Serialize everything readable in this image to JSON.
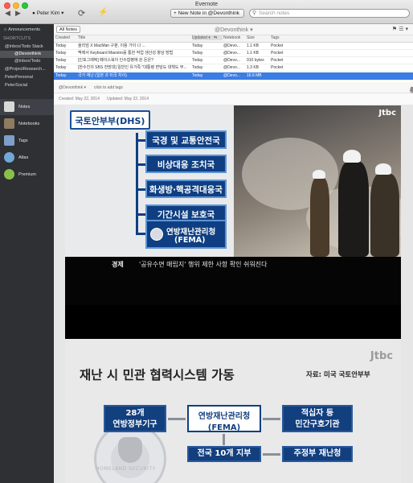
{
  "window": {
    "title": "Evernote"
  },
  "toolbar": {
    "user": "Peter Kim",
    "new_note": "+ New Note in @Devonthink",
    "search_placeholder": "Search notes"
  },
  "sidebar": {
    "announcements": "Announcements",
    "shortcuts_header": "SHORTCUTS",
    "shortcuts": [
      {
        "label": "@Inbox/Todo Stack",
        "selected": false
      },
      {
        "label": "@Devonthink",
        "selected": true
      },
      {
        "label": "@Inbox/Todo",
        "selected": false
      },
      {
        "label": "@ProjectResearch...",
        "selected": false
      },
      {
        "label": "PeterPersonal",
        "selected": false
      },
      {
        "label": "PeterSocial",
        "selected": false
      }
    ],
    "nav": [
      {
        "label": "Notes",
        "selected": true
      },
      {
        "label": "Notebooks",
        "selected": false
      },
      {
        "label": "Tags",
        "selected": false
      },
      {
        "label": "Atlas",
        "selected": false
      },
      {
        "label": "Premium",
        "selected": false
      }
    ]
  },
  "list": {
    "all_notes": "All Notes",
    "context": "@Devonthink",
    "columns": {
      "created": "Created",
      "title": "Title",
      "updated": "Updated",
      "notebook": "Notebook",
      "size": "Size",
      "tags": "Tags"
    },
    "rows": [
      {
        "created": "Today",
        "title": "울리엄 X MacMan 구분, 이용 가이 나 ...",
        "updated": "Today",
        "notebook": "@Devo...",
        "size": "1.1 KB",
        "tags": "Pocket",
        "selected": false
      },
      {
        "created": "Today",
        "title": "맥에서 Keyboard Maestro를 통한 작업 생산성 향상 방법",
        "updated": "Today",
        "notebook": "@Devo...",
        "size": "1.1 KB",
        "tags": "Pocket",
        "selected": false
      },
      {
        "created": "Today",
        "title": "[인포그래픽] 페이스북이 인수합병에 쓴 돈은?",
        "updated": "Today",
        "notebook": "@Devo...",
        "size": "910 bytes",
        "tags": "Pocket",
        "selected": false
      },
      {
        "created": "Today",
        "title": "[한수진의 SBS 전망대] 일반인 유가족 \"대통령 면담도 대책도 무...",
        "updated": "Today",
        "notebook": "@Devo...",
        "size": "1.3 KB",
        "tags": "Pocket",
        "selected": false
      },
      {
        "created": "Today",
        "title": "국가 재난 (일본 과 미국 차이)",
        "updated": "Today",
        "notebook": "@Devo...",
        "size": "16.6 MB",
        "tags": "",
        "selected": true
      }
    ]
  },
  "editor": {
    "notebook": "@Devonthink",
    "add_tags": "click to add tags",
    "created": "Created: May 22, 2014",
    "updated": "Updated: May 22, 2014"
  },
  "slide1": {
    "logo": "Jtbc",
    "top": "국토안부부(DHS)",
    "items": [
      "국경 및 교통안전국",
      "비상대응 조치국",
      "화생방·핵공격대응국",
      "기간시설 보호국"
    ],
    "fema_line1": "연방재난관리청",
    "fema_line2": "(FEMA)",
    "caption_category": "경제",
    "caption_text": "'공유수면 매립지' 행위 제한 사항 확인 쉬워진다"
  },
  "slide2": {
    "logo": "Jtbc",
    "title": "재난 시 민관 협력시스템 가동",
    "source": "자료: 미국 국토안부부",
    "box_left": "28개\n연방정부기구",
    "box_center_1": "연방재난관리청",
    "box_center_2": "(FEMA)",
    "box_right": "적십자 등\n민간구호기관",
    "box_bottom_left": "전국 10개 지부",
    "box_bottom_right": "주정부 재난청",
    "seal_text": "HOMELAND SECURITY"
  },
  "icons": {
    "back": "◀",
    "forward": "▶",
    "sync": "⟳",
    "activity": "⚡",
    "search": "⚲"
  }
}
